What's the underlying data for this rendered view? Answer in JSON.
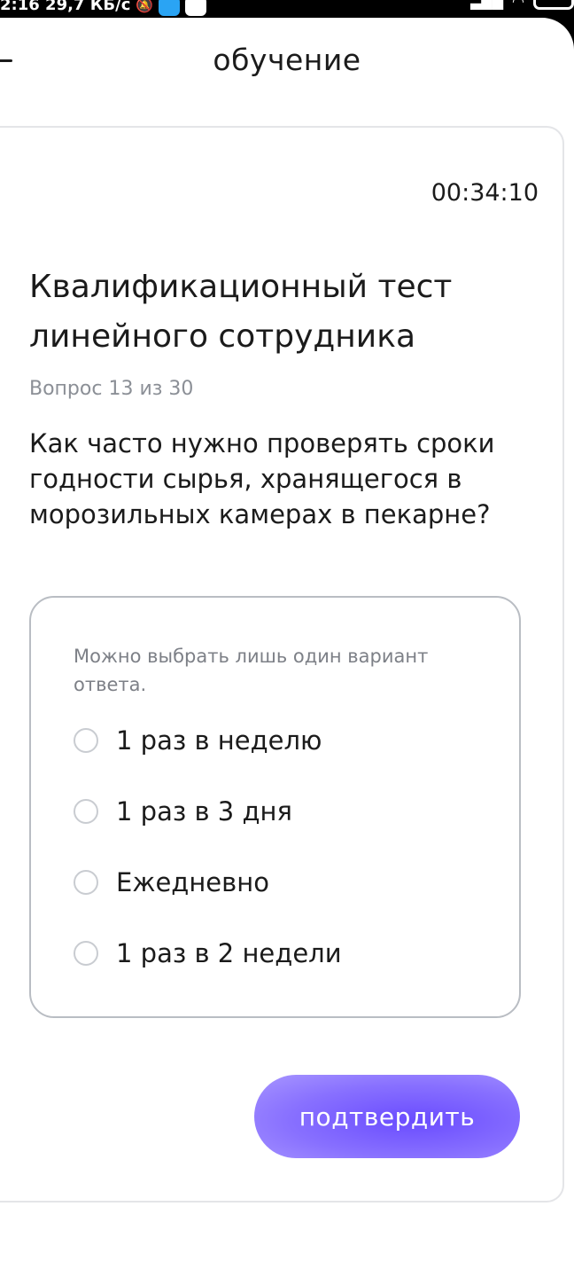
{
  "status_bar": {
    "left_text": "2:16 29,7 КБ/с",
    "icons": [
      "silent-icon",
      "telegram-icon",
      "google-icon"
    ],
    "right_icons": [
      "signal-icon",
      "wifi-icon",
      "battery-icon"
    ]
  },
  "header": {
    "title": "обучение",
    "back_icon": "back-icon"
  },
  "quiz": {
    "timer": "00:34:10",
    "title": "Квалификационный тест линейного сотрудника",
    "counter": "Вопрос 13 из 30",
    "question": "Как часто нужно проверять сроки годности сырья, хранящегося в морозильных камерах в пекарне?",
    "hint": "Можно выбрать лишь один вариант ответа.",
    "options": [
      {
        "label": "1 раз в неделю"
      },
      {
        "label": "1 раз в 3 дня"
      },
      {
        "label": "Ежедневно"
      },
      {
        "label": "1 раз в 2 недели"
      }
    ],
    "confirm_label": "подтвердить"
  },
  "colors": {
    "accent": "#6a4cff",
    "text": "#1b1b1b",
    "muted": "#8b8f96",
    "border": "#b9bdc3"
  }
}
